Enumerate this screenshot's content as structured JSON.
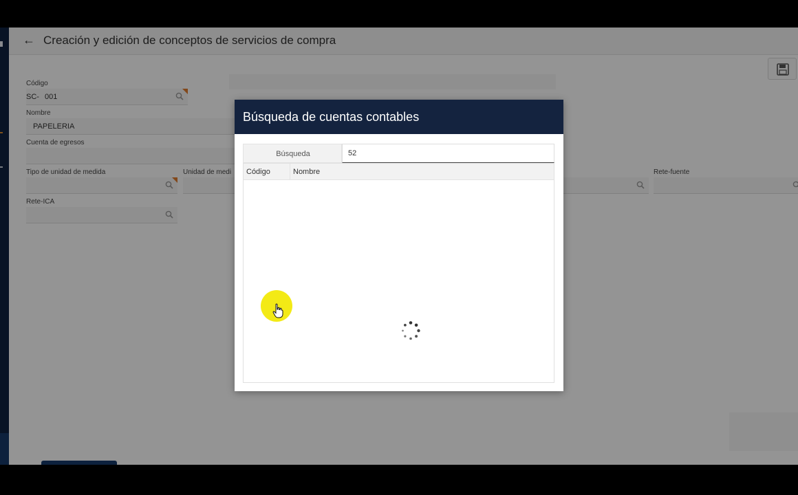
{
  "header": {
    "title": "Creación y edición de conceptos de servicios de compra"
  },
  "form": {
    "codigo": {
      "label": "Código",
      "prefix": "SC-",
      "value": "001"
    },
    "nombre": {
      "label": "Nombre",
      "value": "PAPELERIA"
    },
    "cuenta_egresos": {
      "label": "Cuenta de egresos",
      "value": ""
    },
    "tipo_unidad": {
      "label": "Tipo de unidad de medida",
      "value": ""
    },
    "unidad_medida": {
      "label": "Unidad de medi",
      "value": ""
    },
    "rete_fuente": {
      "label": "Rete-fuente",
      "value": ""
    },
    "rete_ica": {
      "label": "Rete-ICA",
      "value": ""
    }
  },
  "modal": {
    "title": "Búsqueda de cuentas contables",
    "search_label": "Búsqueda",
    "search_value": "52",
    "columns": {
      "code": "Código",
      "name": "Nombre"
    }
  },
  "icons": [
    "back-arrow-icon",
    "save-icon",
    "search-icon",
    "loading-spinner-icon",
    "hand-cursor-icon"
  ],
  "colors": {
    "modal_header": "#14233f",
    "sidebar": "#0f2240",
    "required_marker": "#e07a2e",
    "cursor_highlight": "#f3ea16"
  }
}
